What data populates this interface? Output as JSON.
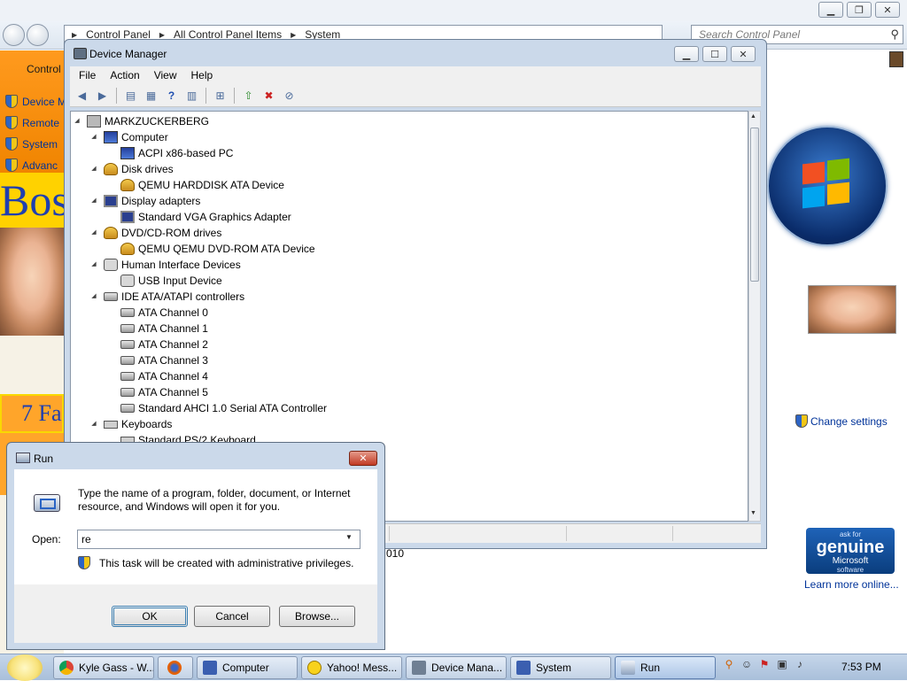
{
  "control_panel": {
    "address": [
      "Control Panel",
      "All Control Panel Items",
      "System"
    ],
    "search_placeholder": "Search Control Panel",
    "left_heading": "Control",
    "left_links": [
      "Device M",
      "Remote",
      "System",
      "Advanc"
    ],
    "bos_text": "Bos",
    "fa_text": "7 Fa",
    "change_settings": "Change settings",
    "genuine_small": "ask for",
    "genuine_big": "genuine",
    "genuine_ms": "Microsoft",
    "genuine_soft": "software",
    "learn_more": "Learn more online...",
    "partial_date": "010"
  },
  "device_manager": {
    "title": "Device Manager",
    "menus": [
      "File",
      "Action",
      "View",
      "Help"
    ],
    "tree": [
      {
        "label": "MARKZUCKERBERG",
        "level": 0,
        "icon": "root",
        "expander": "open"
      },
      {
        "label": "Computer",
        "level": 1,
        "icon": "computer",
        "expander": "open"
      },
      {
        "label": "ACPI x86-based PC",
        "level": 2,
        "icon": "computer",
        "expander": ""
      },
      {
        "label": "Disk drives",
        "level": 1,
        "icon": "disk",
        "expander": "open"
      },
      {
        "label": "QEMU HARDDISK ATA Device",
        "level": 2,
        "icon": "disk",
        "expander": ""
      },
      {
        "label": "Display adapters",
        "level": 1,
        "icon": "monitor",
        "expander": "open"
      },
      {
        "label": "Standard VGA Graphics Adapter",
        "level": 2,
        "icon": "monitor",
        "expander": ""
      },
      {
        "label": "DVD/CD-ROM drives",
        "level": 1,
        "icon": "disk",
        "expander": "open"
      },
      {
        "label": "QEMU QEMU DVD-ROM ATA Device",
        "level": 2,
        "icon": "disk",
        "expander": ""
      },
      {
        "label": "Human Interface Devices",
        "level": 1,
        "icon": "hid",
        "expander": "open"
      },
      {
        "label": "USB Input Device",
        "level": 2,
        "icon": "hid",
        "expander": ""
      },
      {
        "label": "IDE ATA/ATAPI controllers",
        "level": 1,
        "icon": "ide",
        "expander": "open"
      },
      {
        "label": "ATA Channel 0",
        "level": 2,
        "icon": "ide",
        "expander": ""
      },
      {
        "label": "ATA Channel 1",
        "level": 2,
        "icon": "ide",
        "expander": ""
      },
      {
        "label": "ATA Channel 2",
        "level": 2,
        "icon": "ide",
        "expander": ""
      },
      {
        "label": "ATA Channel 3",
        "level": 2,
        "icon": "ide",
        "expander": ""
      },
      {
        "label": "ATA Channel 4",
        "level": 2,
        "icon": "ide",
        "expander": ""
      },
      {
        "label": "ATA Channel 5",
        "level": 2,
        "icon": "ide",
        "expander": ""
      },
      {
        "label": "Standard AHCI 1.0 Serial ATA Controller",
        "level": 2,
        "icon": "ide",
        "expander": ""
      },
      {
        "label": "Keyboards",
        "level": 1,
        "icon": "keyboard",
        "expander": "open"
      },
      {
        "label": "Standard PS/2 Keyboard",
        "level": 2,
        "icon": "keyboard",
        "expander": ""
      }
    ]
  },
  "run_dialog": {
    "title": "Run",
    "description": "Type the name of a program, folder, document, or Internet resource, and Windows will open it for you.",
    "open_label": "Open:",
    "input_value": "re",
    "admin_note": "This task will be created with administrative privileges.",
    "ok_label": "OK",
    "cancel_label": "Cancel",
    "browse_label": "Browse..."
  },
  "taskbar": {
    "tasks": [
      {
        "label": "Kyle Gass - W...",
        "icon": "chrome-icon"
      },
      {
        "label": "",
        "icon": "firefox-icon"
      },
      {
        "label": "Computer",
        "icon": "computer-icon"
      },
      {
        "label": "Yahoo! Mess...",
        "icon": "yahoo-messenger-icon"
      },
      {
        "label": "Device Mana...",
        "icon": "device-manager-icon"
      },
      {
        "label": "System",
        "icon": "system-icon"
      },
      {
        "label": "Run",
        "icon": "run-icon"
      }
    ],
    "clock": "7:53 PM"
  },
  "colors": {
    "accent": "#003399",
    "window_frame": "#cbd9ea",
    "orange_banner": "#f08400"
  }
}
